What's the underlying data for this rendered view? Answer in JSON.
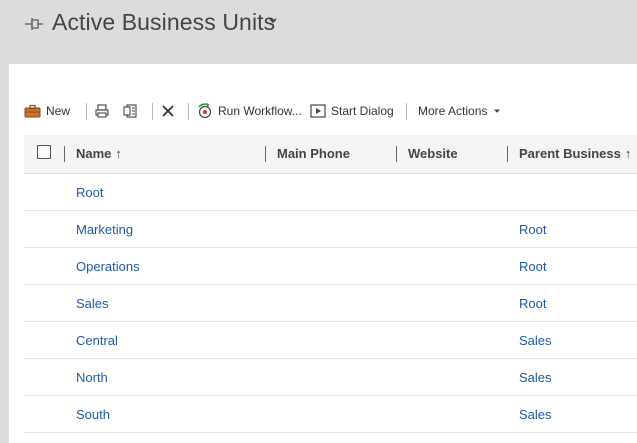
{
  "header": {
    "title": "Active Business Units"
  },
  "toolbar": {
    "new_label": "New",
    "run_workflow_label": "Run Workflow...",
    "start_dialog_label": "Start Dialog",
    "more_actions_label": "More Actions",
    "icons": [
      "new-icon",
      "print-icon",
      "export-icon",
      "delete-icon",
      "workflow-icon",
      "dialog-icon",
      "dropdown-icon"
    ]
  },
  "grid": {
    "columns": [
      {
        "label": "Name",
        "sorted": "ascending"
      },
      {
        "label": "Main Phone"
      },
      {
        "label": "Website"
      },
      {
        "label": "Parent Business",
        "sorted": "ascending"
      }
    ],
    "rows": [
      {
        "name": "Root",
        "main_phone": "",
        "website": "",
        "parent": ""
      },
      {
        "name": "Marketing",
        "main_phone": "",
        "website": "",
        "parent": "Root"
      },
      {
        "name": "Operations",
        "main_phone": "",
        "website": "",
        "parent": "Root"
      },
      {
        "name": "Sales",
        "main_phone": "",
        "website": "",
        "parent": "Root"
      },
      {
        "name": "Central",
        "main_phone": "",
        "website": "",
        "parent": "Sales"
      },
      {
        "name": "North",
        "main_phone": "",
        "website": "",
        "parent": "Sales"
      },
      {
        "name": "South",
        "main_phone": "",
        "website": "",
        "parent": "Sales"
      }
    ]
  },
  "colors": {
    "link": "#1f5aa6",
    "header_bg": "#dcdcdc",
    "grid_header_bg": "#f4f4f4"
  }
}
